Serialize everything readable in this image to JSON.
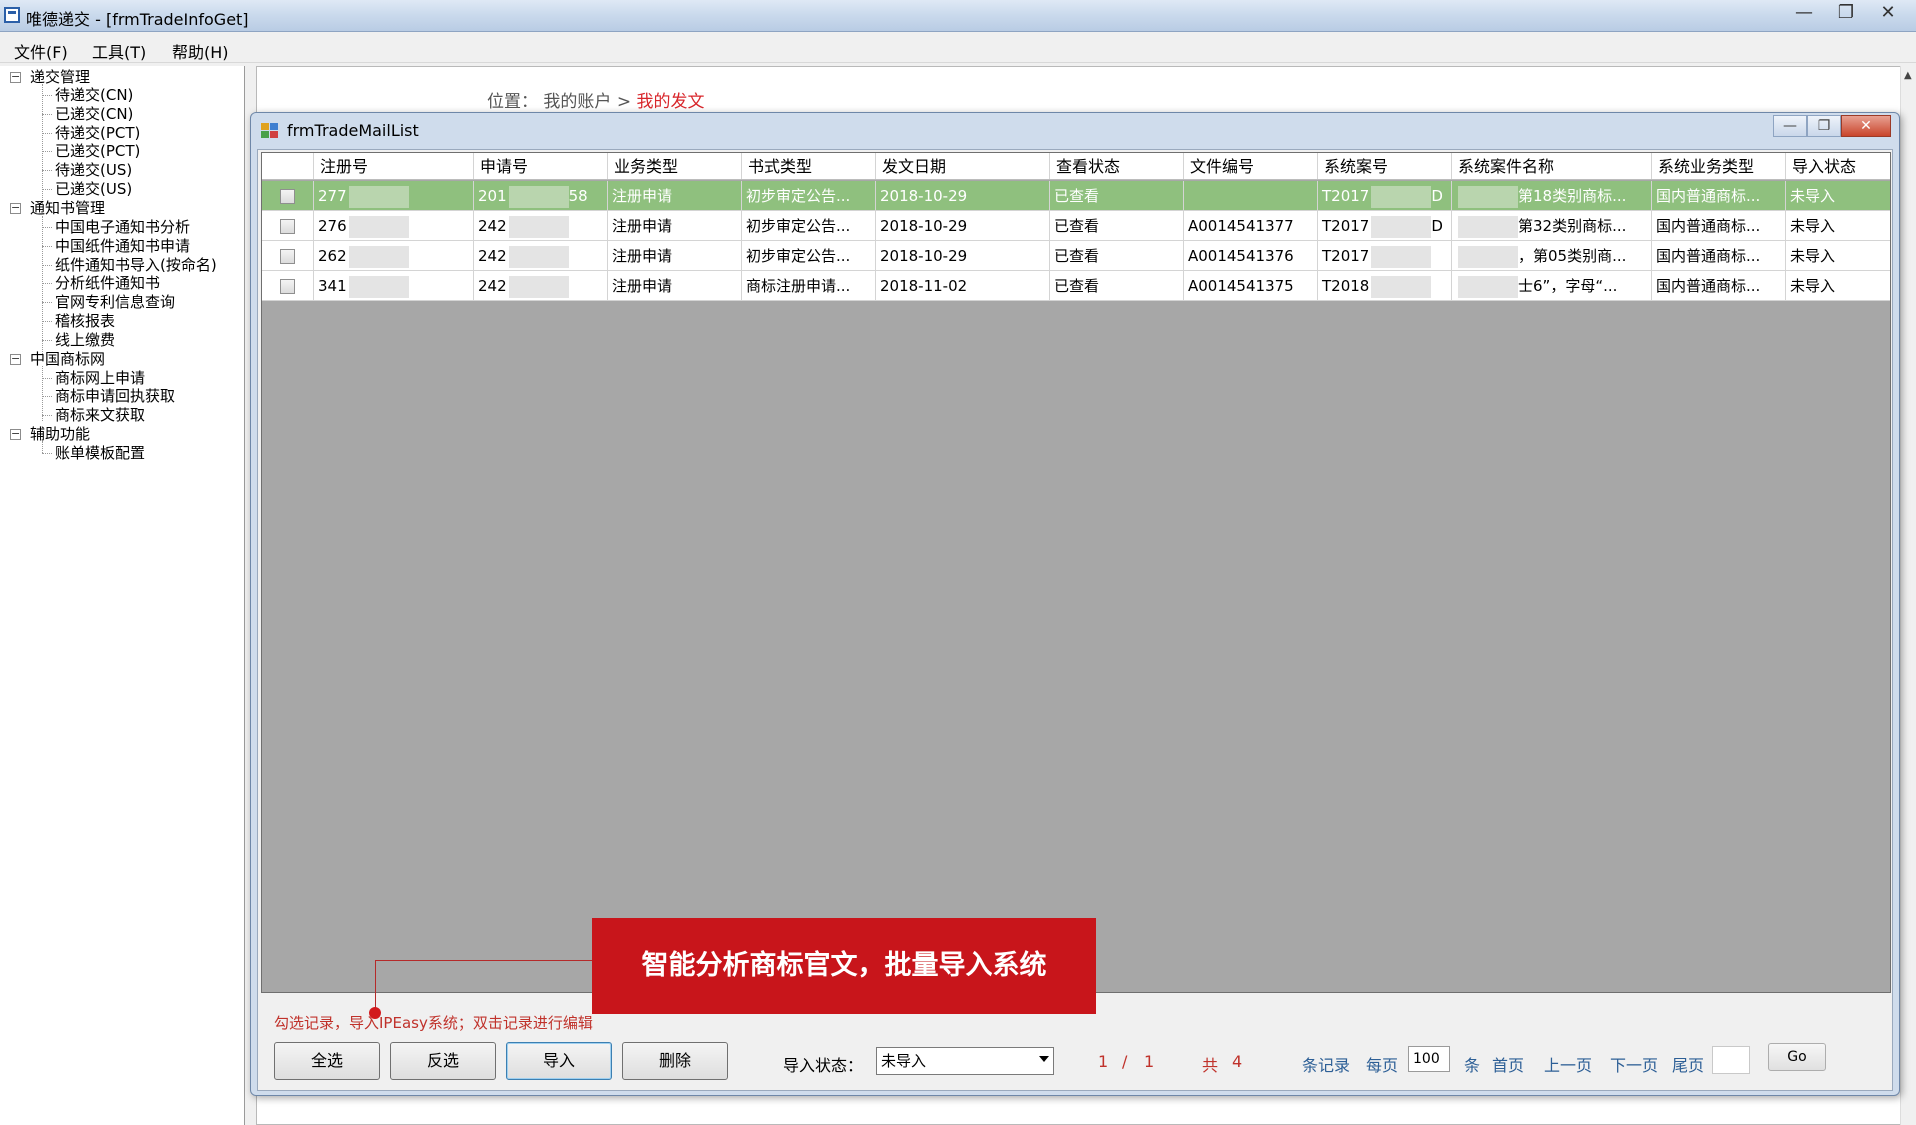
{
  "window": {
    "title": "唯德递交 - [frmTradeInfoGet]",
    "controls": [
      "—",
      "❐",
      "✕"
    ]
  },
  "menu": [
    "文件(F)",
    "工具(T)",
    "帮助(H)"
  ],
  "tree": [
    {
      "label": "递交管理",
      "children": [
        "待递交(CN)",
        "已递交(CN)",
        "待递交(PCT)",
        "已递交(PCT)",
        "待递交(US)",
        "已递交(US)"
      ]
    },
    {
      "label": "通知书管理",
      "children": [
        "中国电子通知书分析",
        "中国纸件通知书申请",
        "纸件通知书导入(按命名)",
        "分析纸件通知书",
        "官网专利信息查询",
        "稽核报表",
        "线上缴费"
      ]
    },
    {
      "label": "中国商标网",
      "children": [
        "商标网上申请",
        "商标申请回执获取",
        "商标来文获取"
      ]
    },
    {
      "label": "辅助功能",
      "children": [
        "账单模板配置"
      ]
    }
  ],
  "breadcrumb": {
    "prefix": "位置：",
    "parent": "我的账户",
    "sep": ">",
    "current": "我的发文"
  },
  "child_window": {
    "title": "frmTradeMailList"
  },
  "grid": {
    "columns": [
      "注册号",
      "申请号",
      "业务类型",
      "书式类型",
      "发文日期",
      "查看状态",
      "文件编号",
      "系统案号",
      "系统案件名称",
      "系统业务类型",
      "导入状态"
    ],
    "rows": [
      [
        "277",
        "201",
        "注册申请",
        "初步审定公告...",
        "2018-10-29",
        "已查看",
        "",
        "T2017",
        "第18类别商标...",
        "国内普通商标...",
        "未导入"
      ],
      [
        "276",
        "242",
        "注册申请",
        "初步审定公告...",
        "2018-10-29",
        "已查看",
        "A0014541377",
        "T2017",
        "第32类别商标...",
        "国内普通商标...",
        "未导入"
      ],
      [
        "262",
        "242",
        "注册申请",
        "初步审定公告...",
        "2018-10-29",
        "已查看",
        "A0014541376",
        "T2017",
        "，第05类别商...",
        "国内普通商标...",
        "未导入"
      ],
      [
        "341",
        "242",
        "注册申请",
        "商标注册申请...",
        "2018-11-02",
        "已查看",
        "A0014541375",
        "T2018",
        "士6”，字母“...",
        "国内普通商标...",
        "未导入"
      ]
    ],
    "row_tails": {
      "r0_app": "58",
      "r0_case": "D",
      "r1_case": "D",
      "r2_case": "",
      "r3_case": ""
    },
    "selected_row": 0,
    "selected_color": "#8fc07e"
  },
  "callout": {
    "text": "智能分析商标官文，批量导入系统",
    "color": "#c8151b"
  },
  "footer": {
    "hint": "勾选记录，导入IPEasy系统；双击记录进行编辑",
    "buttons": [
      "全选",
      "反选",
      "导入",
      "删除"
    ],
    "import_status_label": "导入状态：",
    "import_status_value": "未导入",
    "page_current": "1",
    "page_sep": "/",
    "page_total": "1",
    "total_prefix": "共",
    "total_count": "4",
    "records_label": "条记录",
    "per_page_label": "每页",
    "per_page_value": "100",
    "per_page_unit": "条",
    "first": "首页",
    "prev": "上一页",
    "next": "下一页",
    "last": "尾页",
    "go": "Go"
  }
}
